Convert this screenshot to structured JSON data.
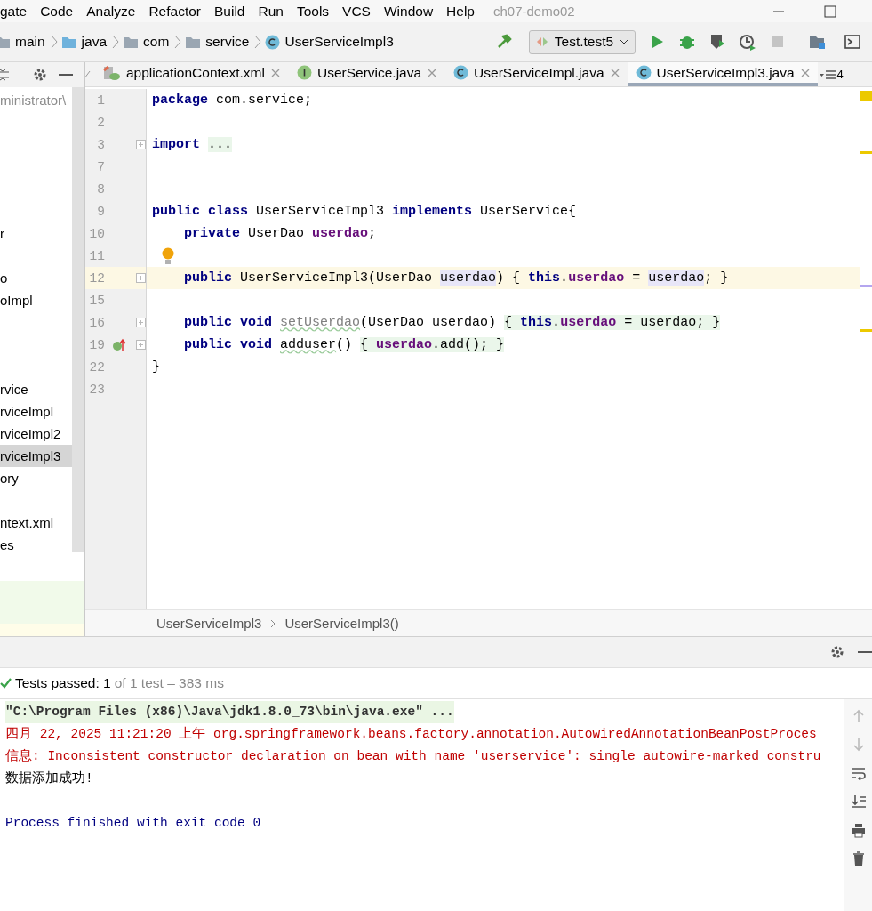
{
  "menu_bar": {
    "items": [
      "gate",
      "Code",
      "Analyze",
      "Refactor",
      "Build",
      "Run",
      "Tools",
      "VCS",
      "Window",
      "Help"
    ],
    "project_title": "ch07-demo02"
  },
  "nav_bar": {
    "crumbs": [
      {
        "label": "main",
        "kind": "folder"
      },
      {
        "label": "java",
        "kind": "source-folder"
      },
      {
        "label": "com",
        "kind": "folder"
      },
      {
        "label": "service",
        "kind": "folder"
      },
      {
        "label": "UserServiceImpl3",
        "kind": "class"
      }
    ],
    "run_config": "Test.test5"
  },
  "project_tree": {
    "items": [
      {
        "label": "ministrator\\",
        "selected": false,
        "dim": true
      },
      {
        "label": "r",
        "selected": false,
        "dim": false
      },
      {
        "label": "o",
        "selected": false,
        "dim": false
      },
      {
        "label": "oImpl",
        "selected": false,
        "dim": false
      },
      {
        "label": "rvice",
        "selected": false,
        "dim": false
      },
      {
        "label": "rviceImpl",
        "selected": false,
        "dim": false
      },
      {
        "label": "rviceImpl2",
        "selected": false,
        "dim": false
      },
      {
        "label": "rviceImpl3",
        "selected": true,
        "dim": false
      },
      {
        "label": "ory",
        "selected": false,
        "dim": false
      },
      {
        "label": "ntext.xml",
        "selected": false,
        "dim": false
      },
      {
        "label": "es",
        "selected": false,
        "dim": false
      }
    ]
  },
  "editor_tabs": [
    {
      "label": "applicationContext.xml",
      "kind": "xml",
      "selected": false
    },
    {
      "label": "UserService.java",
      "kind": "interface",
      "selected": false
    },
    {
      "label": "UserServiceImpl.java",
      "kind": "class",
      "selected": false
    },
    {
      "label": "UserServiceImpl3.java",
      "kind": "class",
      "selected": true
    }
  ],
  "tab_overflow_count": "4",
  "editor": {
    "lines": [
      {
        "number": "1",
        "fold": false,
        "current": false,
        "implements": false,
        "bulb": false,
        "tokens": [
          {
            "t": "package",
            "kind": "kw"
          },
          {
            "t": " com.service;",
            "kind": "plain"
          }
        ]
      },
      {
        "number": "2",
        "fold": false,
        "current": false,
        "implements": false,
        "bulb": false
      },
      {
        "number": "3",
        "fold": true,
        "current": false,
        "implements": false,
        "bulb": false,
        "tokens": [
          {
            "t": "import ",
            "kind": "kw"
          },
          {
            "t": "...",
            "kind": "plain-fold"
          }
        ]
      },
      {
        "number": "7",
        "fold": false,
        "current": false,
        "implements": false,
        "bulb": false
      },
      {
        "number": "8",
        "fold": false,
        "current": false,
        "implements": false,
        "bulb": false
      },
      {
        "number": "9",
        "fold": false,
        "current": false,
        "implements": false,
        "bulb": false,
        "tokens": [
          {
            "t": "public class",
            "kind": "kw"
          },
          {
            "t": " UserServiceImpl3 ",
            "kind": "plain"
          },
          {
            "t": "implements",
            "kind": "kw"
          },
          {
            "t": " UserService{",
            "kind": "plain"
          }
        ]
      },
      {
        "number": "10",
        "fold": false,
        "current": false,
        "implements": false,
        "bulb": false,
        "tokens": [
          {
            "t": "    private",
            "kind": "kw"
          },
          {
            "t": " UserDao ",
            "kind": "plain"
          },
          {
            "t": "userdao",
            "kind": "field"
          },
          {
            "t": ";",
            "kind": "plain"
          }
        ]
      },
      {
        "number": "11",
        "fold": false,
        "current": false,
        "implements": false,
        "bulb": true
      },
      {
        "number": "12",
        "fold": true,
        "current": true,
        "implements": false,
        "bulb": false,
        "tokens": [
          {
            "t": "    public",
            "kind": "kw"
          },
          {
            "t": " UserServiceImpl3(UserDao ",
            "kind": "plain"
          },
          {
            "t": "userdao",
            "kind": "plain-usage"
          },
          {
            "t": ") { ",
            "kind": "plain"
          },
          {
            "t": "this",
            "kind": "kw"
          },
          {
            "t": ".",
            "kind": "plain"
          },
          {
            "t": "userdao",
            "kind": "field"
          },
          {
            "t": " = ",
            "kind": "plain"
          },
          {
            "t": "userdao",
            "kind": "plain-usage"
          },
          {
            "t": "; }",
            "kind": "plain"
          }
        ]
      },
      {
        "number": "15",
        "fold": false,
        "current": false,
        "implements": false,
        "bulb": false
      },
      {
        "number": "16",
        "fold": true,
        "current": false,
        "implements": false,
        "bulb": false,
        "tokens": [
          {
            "t": "    public void ",
            "kind": "kw"
          },
          {
            "t": "setUserdao",
            "kind": "unused-typo"
          },
          {
            "t": "(UserDao userdao) ",
            "kind": "plain"
          },
          {
            "t": "{ ",
            "kind": "plain-fold"
          },
          {
            "t": "this",
            "kind": "kw-fold"
          },
          {
            "t": ".",
            "kind": "plain-fold"
          },
          {
            "t": "userdao",
            "kind": "field-fold"
          },
          {
            "t": " = userdao; }",
            "kind": "plain-fold"
          }
        ]
      },
      {
        "number": "19",
        "fold": true,
        "current": false,
        "implements": true,
        "bulb": false,
        "tokens": [
          {
            "t": "    public void ",
            "kind": "kw"
          },
          {
            "t": "adduser",
            "kind": "plain-typo"
          },
          {
            "t": "() ",
            "kind": "plain"
          },
          {
            "t": "{ ",
            "kind": "plain-fold"
          },
          {
            "t": "userdao",
            "kind": "field-fold"
          },
          {
            "t": ".add(); }",
            "kind": "plain-fold"
          }
        ]
      },
      {
        "number": "22",
        "fold": false,
        "current": false,
        "implements": false,
        "bulb": false,
        "tokens": [
          {
            "t": "}",
            "kind": "plain"
          }
        ]
      },
      {
        "number": "23",
        "fold": false,
        "current": false,
        "implements": false,
        "bulb": false
      }
    ],
    "breadcrumbs": [
      "UserServiceImpl3",
      "UserServiceImpl3()"
    ]
  },
  "run_panel": {
    "status": "Tests passed: 1",
    "detail": "of 1 test – 383 ms",
    "passed": true,
    "console": [
      {
        "kind": "command",
        "text": "\"C:\\Program Files (x86)\\Java\\jdk1.8.0_73\\bin\\java.exe\" ..."
      },
      {
        "kind": "error",
        "text": "四月 22, 2025 11:21:20 上午 org.springframework.beans.factory.annotation.AutowiredAnnotationBeanPostProces"
      },
      {
        "kind": "error",
        "text": "信息: Inconsistent constructor declaration on bean with name 'userservice': single autowire-marked constru"
      },
      {
        "kind": "plain",
        "text": "数据添加成功!"
      },
      {
        "kind": "blank"
      },
      {
        "kind": "system",
        "text": "Process finished with exit code 0"
      }
    ]
  }
}
